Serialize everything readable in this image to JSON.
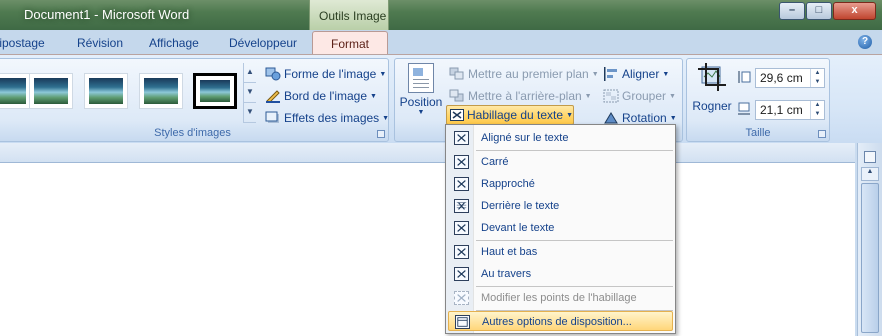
{
  "window": {
    "title": "Document1 - Microsoft Word",
    "contextual_group": "Outils Image",
    "controls": {
      "minimize": "–",
      "maximize": "□",
      "close": "x"
    }
  },
  "tabs": [
    {
      "label": "ilipostage"
    },
    {
      "label": "Révision"
    },
    {
      "label": "Affichage"
    },
    {
      "label": "Développeur"
    },
    {
      "label": "Format",
      "active": true
    }
  ],
  "help": "?",
  "ribbon": {
    "styles_images": {
      "label": "Styles d'images",
      "gallery_count": 5,
      "commands": {
        "forme": "Forme de l'image",
        "bord": "Bord de l'image",
        "effets": "Effets des images"
      }
    },
    "organiser": {
      "position": "Position",
      "premier_plan": "Mettre au premier plan",
      "arriere_plan": "Mettre à l'arrière-plan",
      "habillage": "Habillage du texte",
      "aligner": "Aligner",
      "grouper": "Grouper",
      "rotation": "Rotation"
    },
    "taille": {
      "label": "Taille",
      "rogner": "Rogner",
      "height": "29,6 cm",
      "width": "21,1 cm"
    }
  },
  "menu": {
    "items": [
      {
        "label": "Aligné sur le texte",
        "icon": "inline-wrap-icon"
      },
      {
        "label": "Carré",
        "icon": "square-wrap-icon"
      },
      {
        "label": "Rapproché",
        "icon": "tight-wrap-icon"
      },
      {
        "label": "Derrière le texte",
        "icon": "behind-text-icon"
      },
      {
        "label": "Devant le texte",
        "icon": "in-front-text-icon"
      },
      {
        "label": "Haut et bas",
        "icon": "top-bottom-wrap-icon"
      },
      {
        "label": "Au travers",
        "icon": "through-wrap-icon"
      },
      {
        "label": "Modifier les points de l'habillage",
        "icon": "edit-wrap-points-icon",
        "disabled": true
      },
      {
        "label": "Autres options de disposition...",
        "icon": "more-layout-options-icon",
        "highlighted": true
      }
    ]
  },
  "colors": {
    "accent_tab": "#fde8e5",
    "highlight": "#ffd67a",
    "ribbon_text": "#15428b"
  }
}
